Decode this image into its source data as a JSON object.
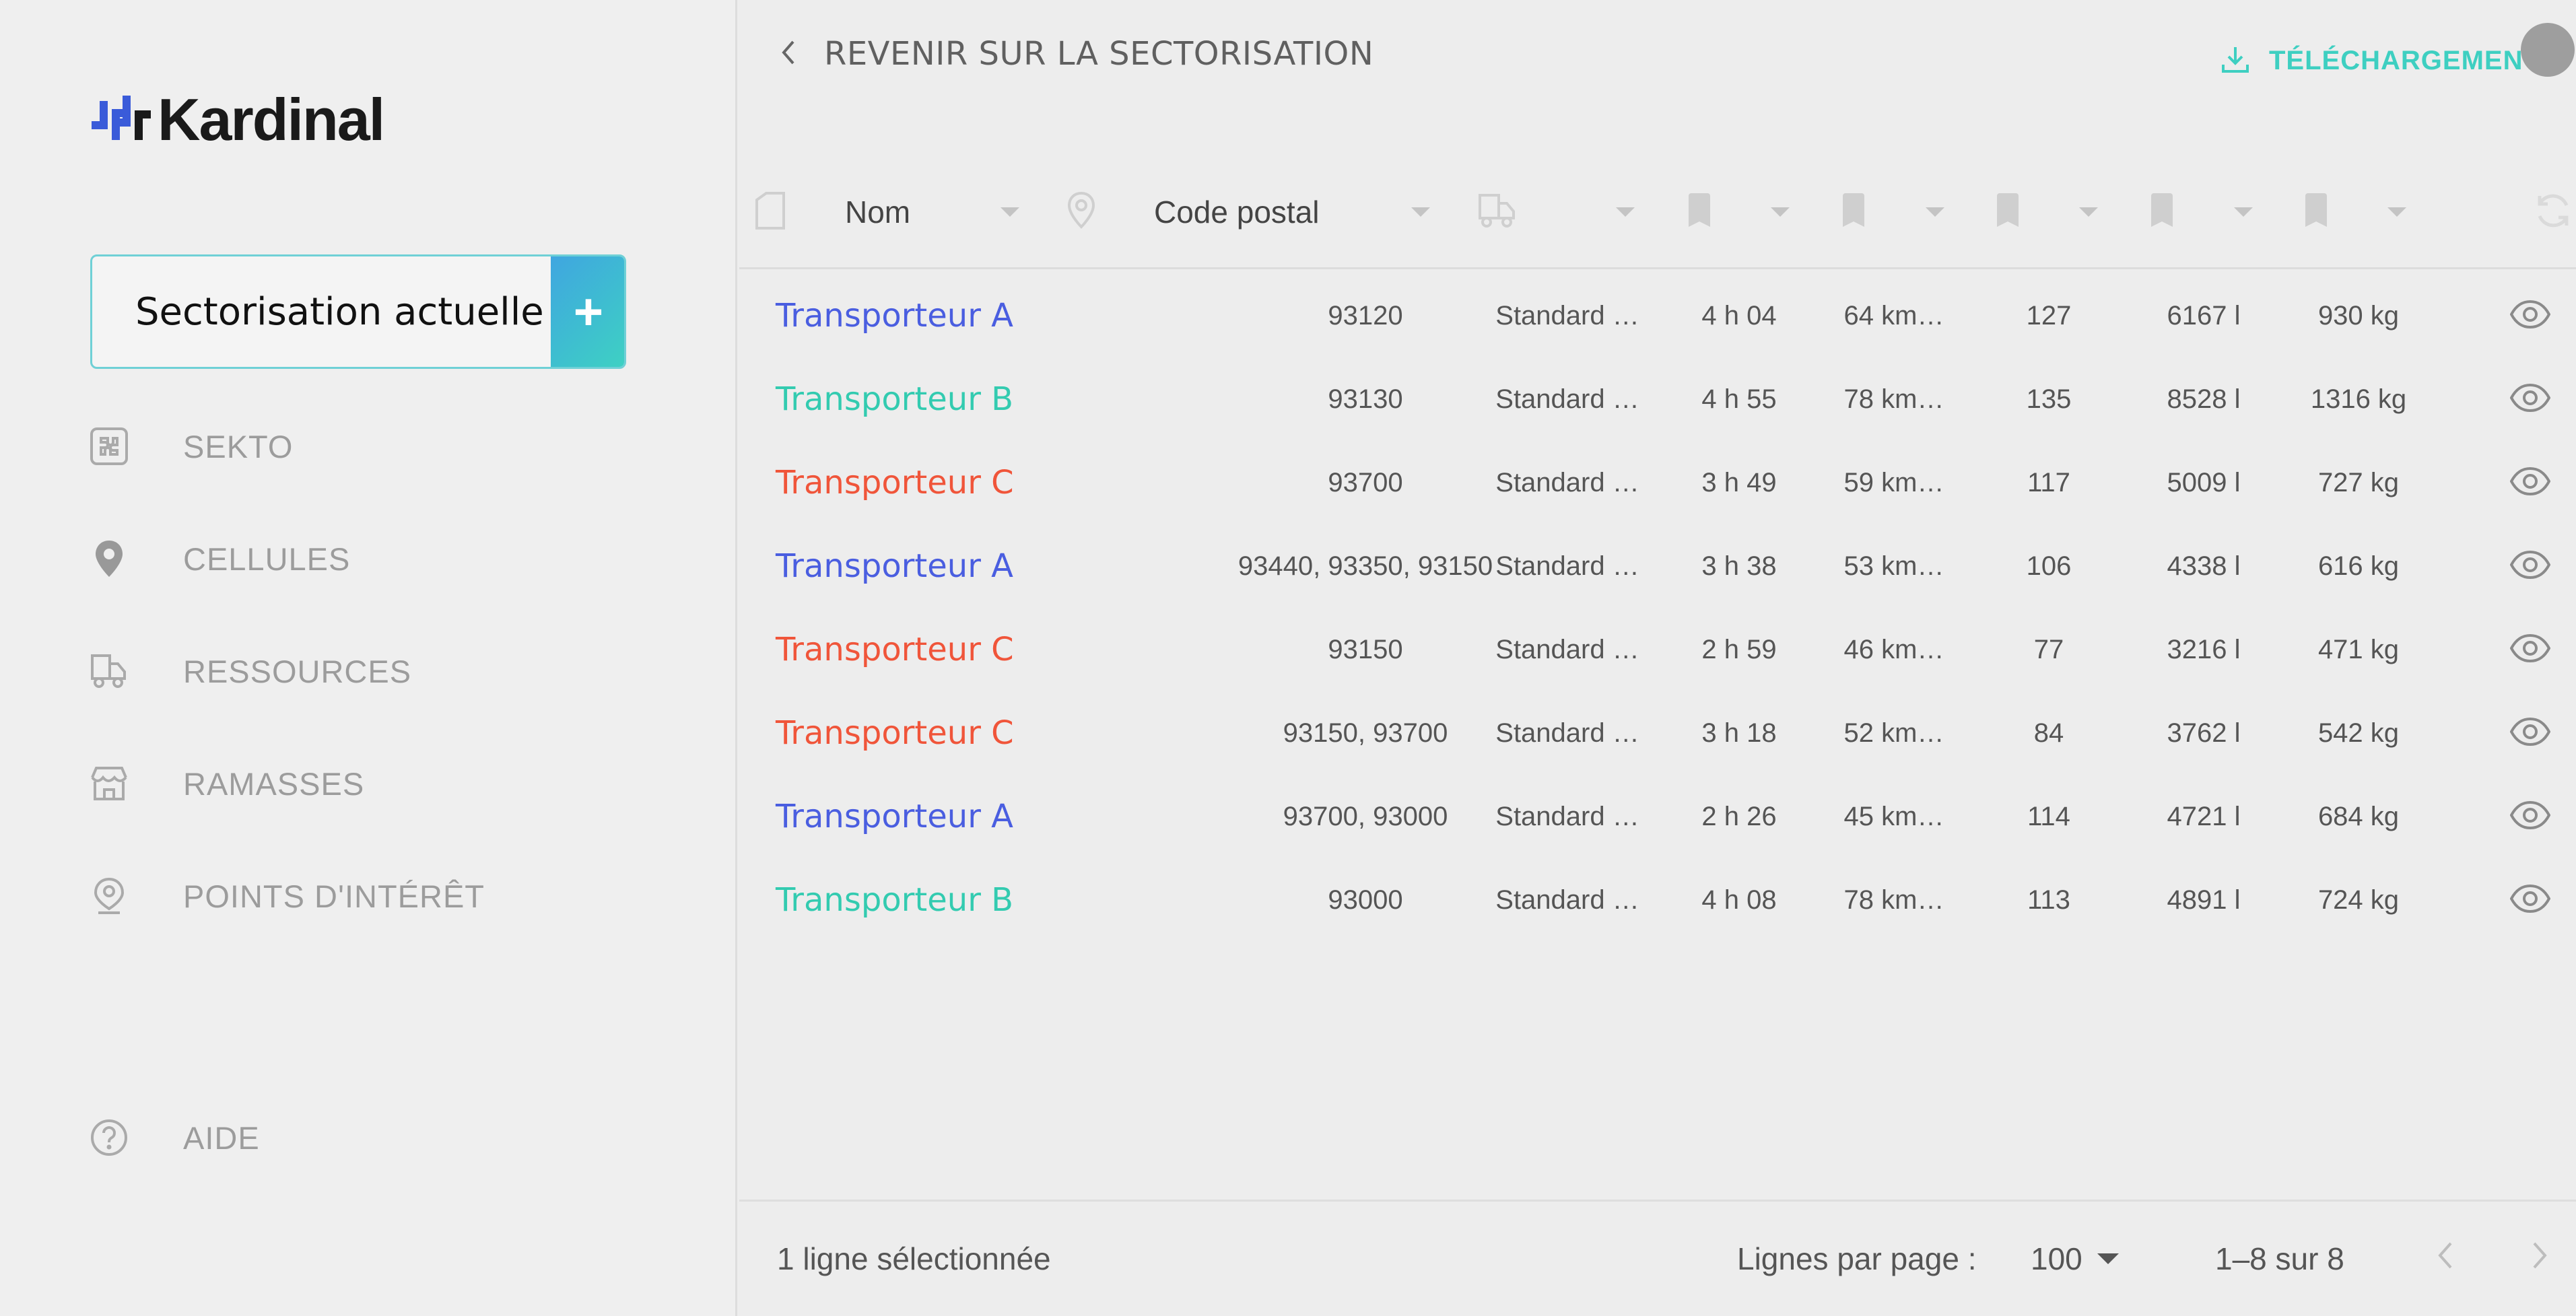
{
  "brand": {
    "name": "Kardinal",
    "mark_color_left": "#3a5bd9",
    "mark_color_right": "#1a1a1a"
  },
  "sidebar": {
    "sector_box": {
      "label": "Sectorisation actuelle",
      "add_label": "+"
    },
    "items": [
      {
        "label": "SEKTO",
        "icon": "puzzle-icon"
      },
      {
        "label": "CELLULES",
        "icon": "location-pin-icon"
      },
      {
        "label": "RESSOURCES",
        "icon": "truck-icon"
      },
      {
        "label": "RAMASSES",
        "icon": "store-icon"
      },
      {
        "label": "POINTS D'INTÉRÊT",
        "icon": "map-pin-icon"
      }
    ],
    "help": {
      "label": "AIDE",
      "icon": "help-circle-icon"
    }
  },
  "header": {
    "back_label": "REVENIR SUR LA SECTORISATION",
    "download_label": "TÉLÉCHARGEMENT"
  },
  "table": {
    "columns": [
      {
        "label": "",
        "icon": "shape-icon"
      },
      {
        "label": "Nom",
        "icon": ""
      },
      {
        "label": "",
        "icon": "location-pin-icon"
      },
      {
        "label": "Code postal",
        "icon": ""
      },
      {
        "label": "",
        "icon": "truck-icon"
      },
      {
        "label": "",
        "icon": "tag-icon"
      },
      {
        "label": "",
        "icon": "tag-icon"
      },
      {
        "label": "",
        "icon": "tag-icon"
      },
      {
        "label": "",
        "icon": "tag-icon"
      },
      {
        "label": "",
        "icon": "tag-icon"
      },
      {
        "label": "",
        "icon": "refresh-icon"
      }
    ],
    "rows": [
      {
        "name": "Transporteur A",
        "color": "#4a5ee0",
        "postal": "93120",
        "vehicle": "Standard …",
        "duration": "4 h 04",
        "distance": "64 km…",
        "count": "127",
        "volume": "6167 l",
        "weight": "930 kg"
      },
      {
        "name": "Transporteur B",
        "color": "#33cbb0",
        "postal": "93130",
        "vehicle": "Standard …",
        "duration": "4 h 55",
        "distance": "78 km…",
        "count": "135",
        "volume": "8528 l",
        "weight": "1316 kg"
      },
      {
        "name": "Transporteur C",
        "color": "#f0553a",
        "postal": "93700",
        "vehicle": "Standard …",
        "duration": "3 h 49",
        "distance": "59 km…",
        "count": "117",
        "volume": "5009 l",
        "weight": "727 kg"
      },
      {
        "name": "Transporteur A",
        "color": "#4a5ee0",
        "postal": "93440, 93350, 93150",
        "vehicle": "Standard …",
        "duration": "3 h 38",
        "distance": "53 km…",
        "count": "106",
        "volume": "4338 l",
        "weight": "616 kg"
      },
      {
        "name": "Transporteur C",
        "color": "#f0553a",
        "postal": "93150",
        "vehicle": "Standard …",
        "duration": "2 h 59",
        "distance": "46 km…",
        "count": "77",
        "volume": "3216 l",
        "weight": "471 kg"
      },
      {
        "name": "Transporteur C",
        "color": "#f0553a",
        "postal": "93150, 93700",
        "vehicle": "Standard …",
        "duration": "3 h 18",
        "distance": "52 km…",
        "count": "84",
        "volume": "3762 l",
        "weight": "542 kg"
      },
      {
        "name": "Transporteur A",
        "color": "#4a5ee0",
        "postal": "93700, 93000",
        "vehicle": "Standard …",
        "duration": "2 h 26",
        "distance": "45 km…",
        "count": "114",
        "volume": "4721 l",
        "weight": "684 kg"
      },
      {
        "name": "Transporteur B",
        "color": "#33cbb0",
        "postal": "93000",
        "vehicle": "Standard …",
        "duration": "4 h 08",
        "distance": "78 km…",
        "count": "113",
        "volume": "4891 l",
        "weight": "724 kg"
      }
    ]
  },
  "footer": {
    "selected_text": "1 ligne sélectionnée",
    "rows_per_page_label": "Lignes par page :",
    "rows_per_page_value": "100",
    "range_text": "1–8 sur 8"
  },
  "colors": {
    "accent": "#3ecfc1",
    "muted": "#9c9c9c",
    "icon": "#c8c8c8"
  }
}
